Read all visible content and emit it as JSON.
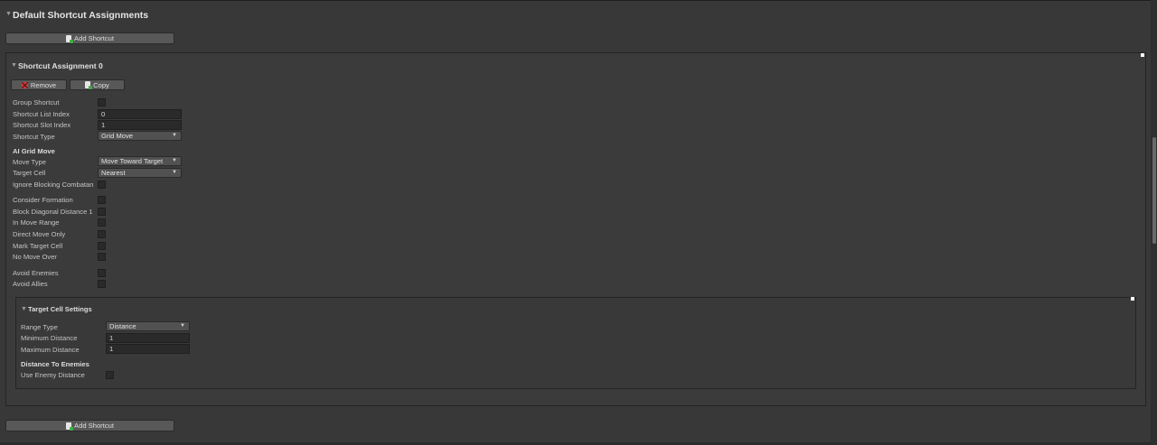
{
  "section": {
    "title": "Default Shortcut Assignments",
    "add_label": "Add Shortcut"
  },
  "assignment": {
    "title": "Shortcut Assignment 0",
    "remove_label": "Remove",
    "copy_label": "Copy",
    "fields": {
      "group_shortcut": "Group Shortcut",
      "list_index_label": "Shortcut List Index",
      "list_index_value": "0",
      "slot_index_label": "Shortcut Slot Index",
      "slot_index_value": "1",
      "type_label": "Shortcut Type",
      "type_value": "Grid Move"
    },
    "ai_grid_move": {
      "header": "AI Grid Move",
      "move_type_label": "Move Type",
      "move_type_value": "Move Toward Target",
      "target_cell_label": "Target Cell",
      "target_cell_value": "Nearest",
      "ignore_blocking": "Ignore Blocking Combatan",
      "consider_formation": "Consider Formation",
      "block_diagonal": "Block Diagonal Distance 1",
      "in_move_range": "In Move Range",
      "direct_move_only": "Direct Move Only",
      "mark_target_cell": "Mark Target Cell",
      "no_move_over": "No Move Over",
      "avoid_enemies": "Avoid Enemies",
      "avoid_allies": "Avoid Allies"
    },
    "target_cell_settings": {
      "title": "Target Cell Settings",
      "range_type_label": "Range Type",
      "range_type_value": "Distance",
      "min_distance_label": "Minimum Distance",
      "min_distance_value": "1",
      "max_distance_label": "Maximum Distance",
      "max_distance_value": "1",
      "distance_to_enemies_header": "Distance To Enemies",
      "use_enemy_distance": "Use Enemy Distance"
    }
  },
  "glyphs": {
    "foldout": "▼",
    "dropdown_arrow": "▼"
  },
  "icons": {
    "add": "add-document-icon",
    "remove": "remove-icon",
    "copy": "copy-icon"
  }
}
